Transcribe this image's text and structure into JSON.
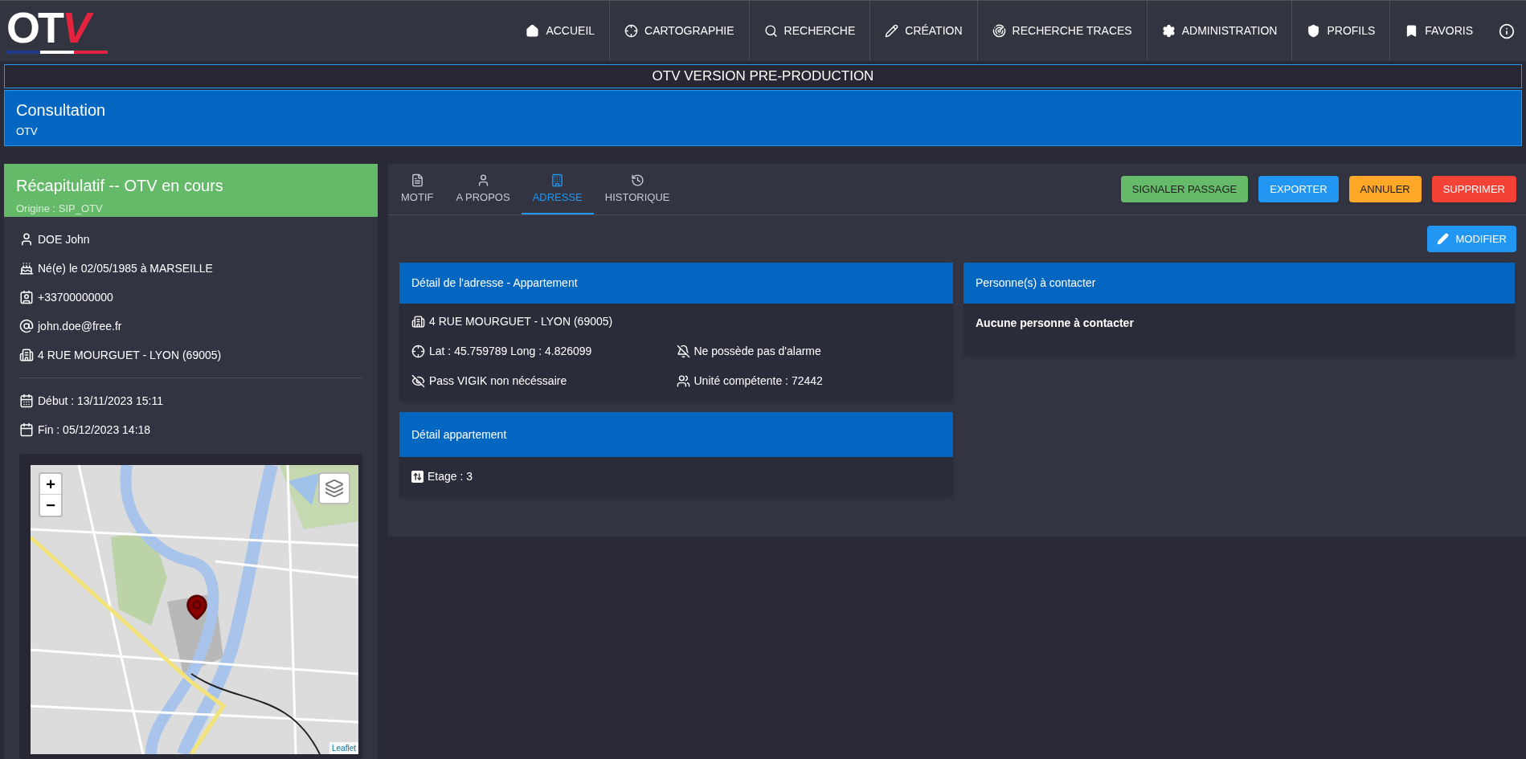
{
  "logo": {
    "main": "OT",
    "accent": "V"
  },
  "nav": [
    {
      "label": "ACCUEIL"
    },
    {
      "label": "CARTOGRAPHIE"
    },
    {
      "label": "RECHERCHE"
    },
    {
      "label": "CRÉATION"
    },
    {
      "label": "RECHERCHE TRACES"
    },
    {
      "label": "ADMINISTRATION"
    },
    {
      "label": "PROFILS"
    },
    {
      "label": "FAVORIS"
    }
  ],
  "banner": "OTV VERSION PRE-PRODUCTION",
  "page_header": {
    "title": "Consultation",
    "subtitle": "OTV"
  },
  "summary": {
    "title": "Récapitulatif -- OTV en cours",
    "origin": "Origine : SIP_OTV",
    "details": [
      "DOE John",
      "Né(e) le 02/05/1985 à MARSEILLE",
      "+33700000000",
      "john.doe@free.fr",
      "4 RUE MOURGUET - LYON (69005)"
    ],
    "dates": [
      "Début : 13/11/2023 15:11",
      "Fin : 05/12/2023 14:18"
    ],
    "map": {
      "zoom_in": "+",
      "zoom_out": "−",
      "attribution": "Leaflet"
    }
  },
  "tabs": [
    {
      "label": "MOTIF",
      "selected": false
    },
    {
      "label": "A PROPOS",
      "selected": false
    },
    {
      "label": "ADRESSE",
      "selected": true
    },
    {
      "label": "HISTORIQUE",
      "selected": false
    }
  ],
  "actions": [
    {
      "label": "SIGNALER PASSAGE",
      "color": "#66bb6a"
    },
    {
      "label": "EXPORTER",
      "color": "#2196f3"
    },
    {
      "label": "ANNULER",
      "color": "#ffa726"
    },
    {
      "label": "SUPPRIMER",
      "color": "#f44336"
    }
  ],
  "edit_button": "MODIFIER",
  "address_card": {
    "title": "Détail de l'adresse - Appartement",
    "address": "4 RUE MOURGUET - LYON (69005)",
    "fields": [
      "Lat : 45.759789 Long : 4.826099",
      "Ne possède pas d'alarme",
      "Pass VIGIK non nécéssaire",
      "Unité compétente : 72442"
    ]
  },
  "apartment_card": {
    "title": "Détail appartement",
    "fields": [
      "Etage : 3"
    ]
  },
  "contacts_card": {
    "title": "Personne(s) à contacter",
    "message": "Aucune personne à contacter"
  }
}
